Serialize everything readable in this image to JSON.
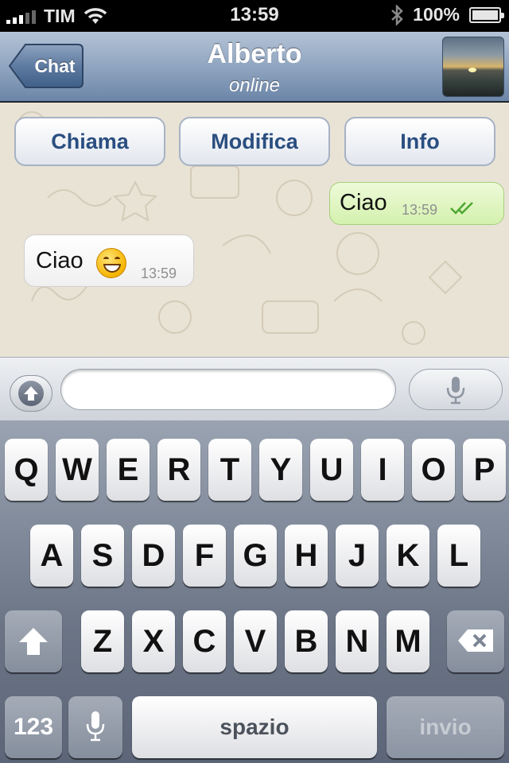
{
  "status_bar": {
    "carrier": "TIM",
    "time": "13:59",
    "battery": "100%",
    "battery_level": 1.0,
    "icons": [
      "signal-icon",
      "wifi-icon",
      "bluetooth-icon",
      "battery-icon"
    ]
  },
  "nav": {
    "back_label": "Chat",
    "title": "Alberto",
    "subtitle": "online",
    "avatar_icon": "contact-avatar"
  },
  "actions": {
    "call_label": "Chiama",
    "edit_label": "Modifica",
    "info_label": "Info"
  },
  "messages": [
    {
      "direction": "outgoing",
      "text": "Ciao",
      "time": "13:59",
      "status_icon": "double-check-icon"
    },
    {
      "direction": "incoming",
      "text": "Ciao",
      "time": "13:59",
      "emoji_icon": "grinning-emoji"
    }
  ],
  "composer": {
    "value": "",
    "placeholder": "",
    "attach_icon": "upload-arrow-icon",
    "voice_icon": "microphone-icon"
  },
  "keyboard": {
    "row1": [
      "Q",
      "W",
      "E",
      "R",
      "T",
      "Y",
      "U",
      "I",
      "O",
      "P"
    ],
    "row2": [
      "A",
      "S",
      "D",
      "F",
      "G",
      "H",
      "J",
      "K",
      "L"
    ],
    "row3": [
      "Z",
      "X",
      "C",
      "V",
      "B",
      "N",
      "M"
    ],
    "numbers_label": "123",
    "space_label": "spazio",
    "enter_label": "invio",
    "shift_icon": "shift-icon",
    "delete_icon": "backspace-icon",
    "dictation_icon": "microphone-icon"
  },
  "colors": {
    "outgoing_bubble": "#dcf8c6",
    "action_text": "#2a4e80",
    "check_marks": "#4fa832"
  }
}
